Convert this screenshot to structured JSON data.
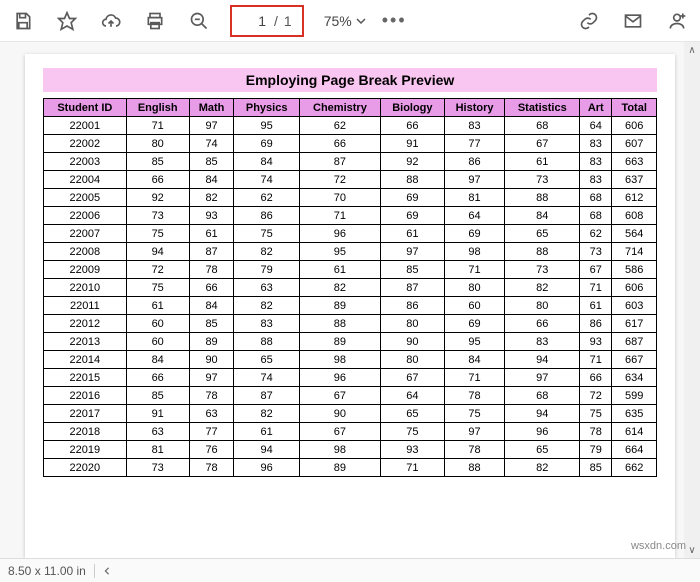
{
  "toolbar": {
    "page_current": "1",
    "page_sep": "/",
    "page_total": "1",
    "zoom": "75%"
  },
  "document": {
    "title": "Employing Page Break Preview",
    "headers": [
      "Student ID",
      "English",
      "Math",
      "Physics",
      "Chemistry",
      "Biology",
      "History",
      "Statistics",
      "Art",
      "Total"
    ],
    "rows": [
      [
        "22001",
        "71",
        "97",
        "95",
        "62",
        "66",
        "83",
        "68",
        "64",
        "606"
      ],
      [
        "22002",
        "80",
        "74",
        "69",
        "66",
        "91",
        "77",
        "67",
        "83",
        "607"
      ],
      [
        "22003",
        "85",
        "85",
        "84",
        "87",
        "92",
        "86",
        "61",
        "83",
        "663"
      ],
      [
        "22004",
        "66",
        "84",
        "74",
        "72",
        "88",
        "97",
        "73",
        "83",
        "637"
      ],
      [
        "22005",
        "92",
        "82",
        "62",
        "70",
        "69",
        "81",
        "88",
        "68",
        "612"
      ],
      [
        "22006",
        "73",
        "93",
        "86",
        "71",
        "69",
        "64",
        "84",
        "68",
        "608"
      ],
      [
        "22007",
        "75",
        "61",
        "75",
        "96",
        "61",
        "69",
        "65",
        "62",
        "564"
      ],
      [
        "22008",
        "94",
        "87",
        "82",
        "95",
        "97",
        "98",
        "88",
        "73",
        "714"
      ],
      [
        "22009",
        "72",
        "78",
        "79",
        "61",
        "85",
        "71",
        "73",
        "67",
        "586"
      ],
      [
        "22010",
        "75",
        "66",
        "63",
        "82",
        "87",
        "80",
        "82",
        "71",
        "606"
      ],
      [
        "22011",
        "61",
        "84",
        "82",
        "89",
        "86",
        "60",
        "80",
        "61",
        "603"
      ],
      [
        "22012",
        "60",
        "85",
        "83",
        "88",
        "80",
        "69",
        "66",
        "86",
        "617"
      ],
      [
        "22013",
        "60",
        "89",
        "88",
        "89",
        "90",
        "95",
        "83",
        "93",
        "687"
      ],
      [
        "22014",
        "84",
        "90",
        "65",
        "98",
        "80",
        "84",
        "94",
        "71",
        "667"
      ],
      [
        "22015",
        "66",
        "97",
        "74",
        "96",
        "67",
        "71",
        "97",
        "66",
        "634"
      ],
      [
        "22016",
        "85",
        "78",
        "87",
        "67",
        "64",
        "78",
        "68",
        "72",
        "599"
      ],
      [
        "22017",
        "91",
        "63",
        "82",
        "90",
        "65",
        "75",
        "94",
        "75",
        "635"
      ],
      [
        "22018",
        "63",
        "77",
        "61",
        "67",
        "75",
        "97",
        "96",
        "78",
        "614"
      ],
      [
        "22019",
        "81",
        "76",
        "94",
        "98",
        "93",
        "78",
        "65",
        "79",
        "664"
      ],
      [
        "22020",
        "73",
        "78",
        "96",
        "89",
        "71",
        "88",
        "82",
        "85",
        "662"
      ]
    ]
  },
  "statusbar": {
    "page_size": "8.50 x 11.00 in"
  },
  "watermark": "wsxdn.com"
}
